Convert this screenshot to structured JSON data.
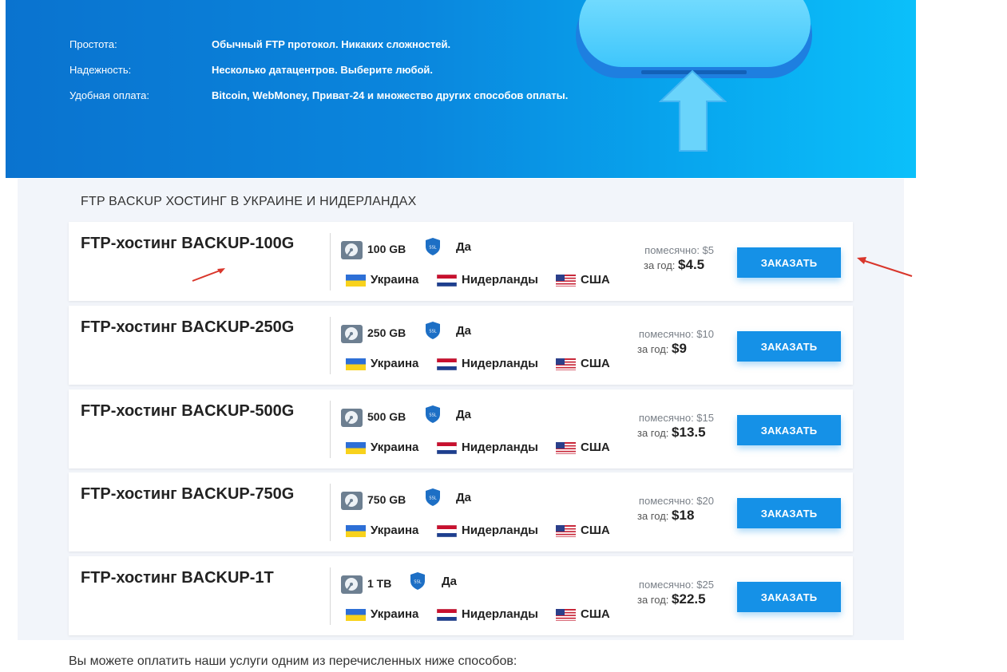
{
  "hero": {
    "features": [
      {
        "label": "Простота:",
        "value": "Обычный FTP протокол. Никаких сложностей."
      },
      {
        "label": "Надежность:",
        "value": "Несколько датацентров. Выберите любой."
      },
      {
        "label": "Удобная оплата:",
        "value": "Bitcoin, WebMoney, Приват-24 и множество других способов оплаты."
      }
    ]
  },
  "section_title": "FTP BACKUP ХОСТИНГ В УКРАИНЕ И НИДЕРЛАНДАХ",
  "plans": [
    {
      "name": "FTP-хостинг BACKUP-100G",
      "size": "100 GB",
      "ssl": "Да",
      "monthly": "помесячно: $5",
      "yearly_label": "за год:",
      "yearly_price": "$4.5",
      "order": "ЗАКАЗАТЬ"
    },
    {
      "name": "FTP-хостинг BACKUP-250G",
      "size": "250 GB",
      "ssl": "Да",
      "monthly": "помесячно: $10",
      "yearly_label": "за год:",
      "yearly_price": "$9",
      "order": "ЗАКАЗАТЬ"
    },
    {
      "name": "FTP-хостинг BACKUP-500G",
      "size": "500 GB",
      "ssl": "Да",
      "monthly": "помесячно: $15",
      "yearly_label": "за год:",
      "yearly_price": "$13.5",
      "order": "ЗАКАЗАТЬ"
    },
    {
      "name": "FTP-хостинг BACKUP-750G",
      "size": "750 GB",
      "ssl": "Да",
      "monthly": "помесячно: $20",
      "yearly_label": "за год:",
      "yearly_price": "$18",
      "order": "ЗАКАЗАТЬ"
    },
    {
      "name": "FTP-хостинг BACKUP-1T",
      "size": "1 TB",
      "ssl": "Да",
      "monthly": "помесячно: $25",
      "yearly_label": "за год:",
      "yearly_price": "$22.5",
      "order": "ЗАКАЗАТЬ"
    }
  ],
  "countries": [
    "Украина",
    "Нидерланды",
    "США"
  ],
  "ssl_badge": "SSL",
  "footer_text": "Вы можете оплатить наши услуги одним из перечисленных ниже способов:",
  "colors": {
    "accent": "#1591e7",
    "hero_start": "#0a73cf",
    "hero_end": "#0bc0fa",
    "annotation": "#d9362b"
  }
}
